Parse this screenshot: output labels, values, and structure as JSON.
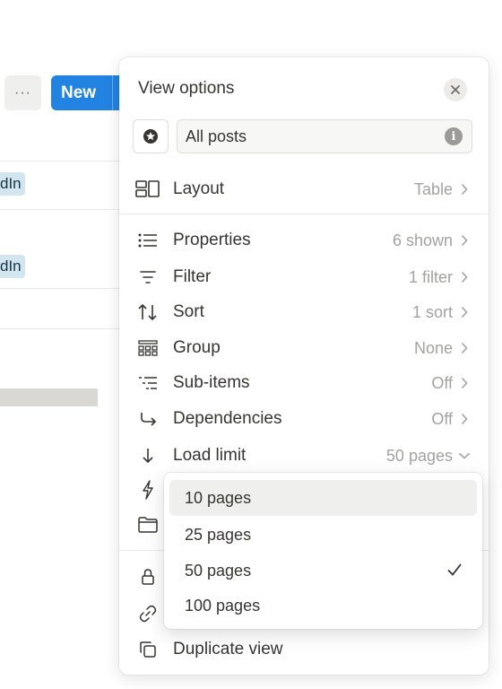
{
  "background": {
    "more_label": "···",
    "new_button": "New",
    "tags": [
      "dIn",
      "dIn"
    ]
  },
  "panel": {
    "title": "View options",
    "view_name": "All posts",
    "rows": [
      {
        "icon": "layout-icon",
        "label": "Layout",
        "value": "Table"
      },
      {
        "icon": "properties-icon",
        "label": "Properties",
        "value": "6 shown"
      },
      {
        "icon": "filter-icon",
        "label": "Filter",
        "value": "1 filter"
      },
      {
        "icon": "sort-icon",
        "label": "Sort",
        "value": "1 sort"
      },
      {
        "icon": "group-icon",
        "label": "Group",
        "value": "None"
      },
      {
        "icon": "sub-items-icon",
        "label": "Sub-items",
        "value": "Off"
      },
      {
        "icon": "dependencies-icon",
        "label": "Dependencies",
        "value": "Off"
      },
      {
        "icon": "arrow-down-icon",
        "label": "Load limit",
        "value": "50 pages"
      }
    ],
    "bottom_rows": [
      {
        "icon": "copy-icon",
        "label": "Duplicate view"
      }
    ]
  },
  "load_limit_dropdown": {
    "options": [
      "10 pages",
      "25 pages",
      "50 pages",
      "100 pages"
    ],
    "selected": "50 pages",
    "hovered": "10 pages"
  },
  "colors": {
    "accent": "#2383e2",
    "tag_bg": "#d3e5ef",
    "muted_text": "#a3a29e"
  }
}
